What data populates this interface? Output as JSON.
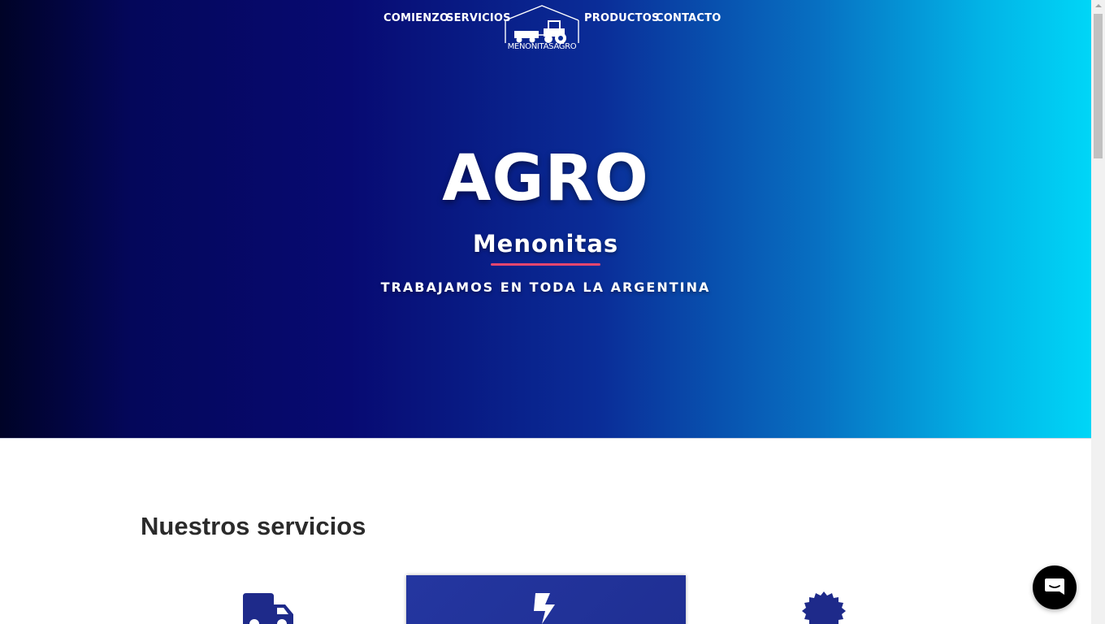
{
  "nav": {
    "items": [
      {
        "label": "COMIENZO"
      },
      {
        "label": "SERVICIOS"
      },
      {
        "label": "PRODUCTOS"
      },
      {
        "label": "CONTACTO"
      }
    ],
    "logo_text": "MENONITASAGRO"
  },
  "hero": {
    "title": "AGRO",
    "subtitle": "Menonitas",
    "tagline": "TRABAJAMOS EN TODA LA ARGENTINA",
    "accent_color": "#e8466e"
  },
  "services": {
    "heading": "Nuestros servicios",
    "icons": [
      "truck-icon",
      "bolt-icon",
      "certificate-badge-icon"
    ],
    "card_color": "#1f2f93"
  },
  "chat": {
    "icon": "chat-bubble-icon"
  }
}
